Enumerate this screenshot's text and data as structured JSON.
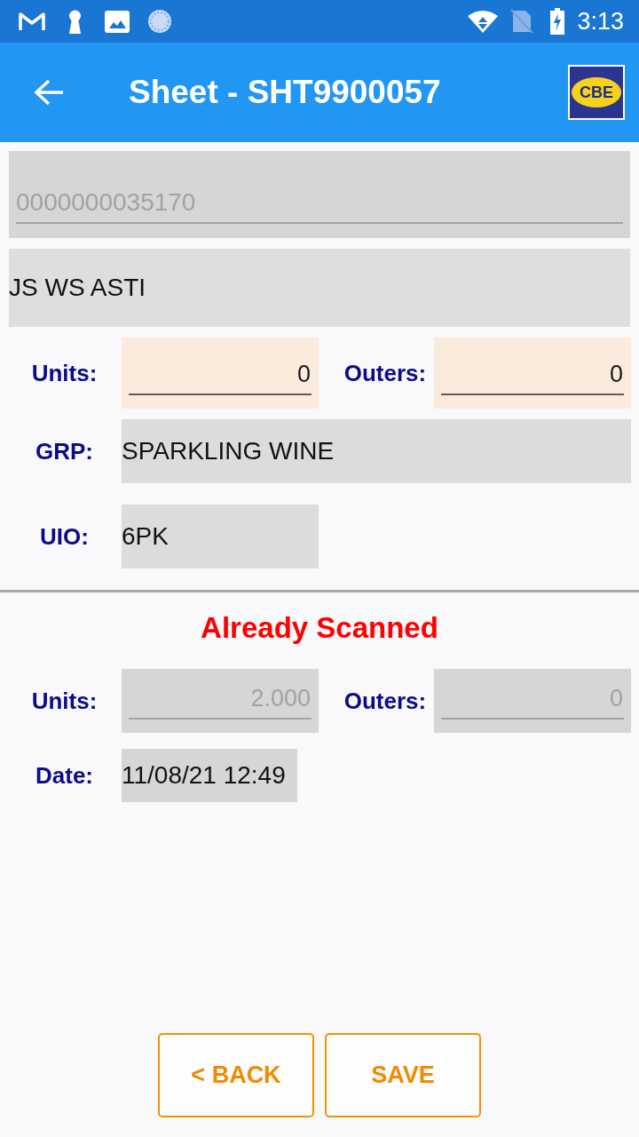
{
  "status_bar": {
    "time": "3:13"
  },
  "app_bar": {
    "title": "Sheet - SHT9900057",
    "logo_text": "CBE"
  },
  "barcode_field": {
    "value": "0000000035170",
    "disabled": true
  },
  "description": "JS WS ASTI",
  "quantity_fields": [
    {
      "label": "Units:",
      "value": "0",
      "disabled": false
    },
    {
      "label": "Outers:",
      "value": "0",
      "disabled": false
    }
  ],
  "group": {
    "label": "GRP:",
    "value": "SPARKLING WINE"
  },
  "uio": {
    "label": "UIO:",
    "value": "6PK"
  },
  "scan_info": {
    "title": "Already Scanned",
    "quantity_fields": [
      {
        "label": "Units:",
        "value": "2.000",
        "disabled": true
      },
      {
        "label": "Outers:",
        "value": "0",
        "disabled": true
      }
    ],
    "date": {
      "label": "Date:",
      "value": "11/08/21 12:49"
    }
  },
  "buttons": [
    {
      "label": "< BACK"
    },
    {
      "label": "SAVE"
    }
  ]
}
